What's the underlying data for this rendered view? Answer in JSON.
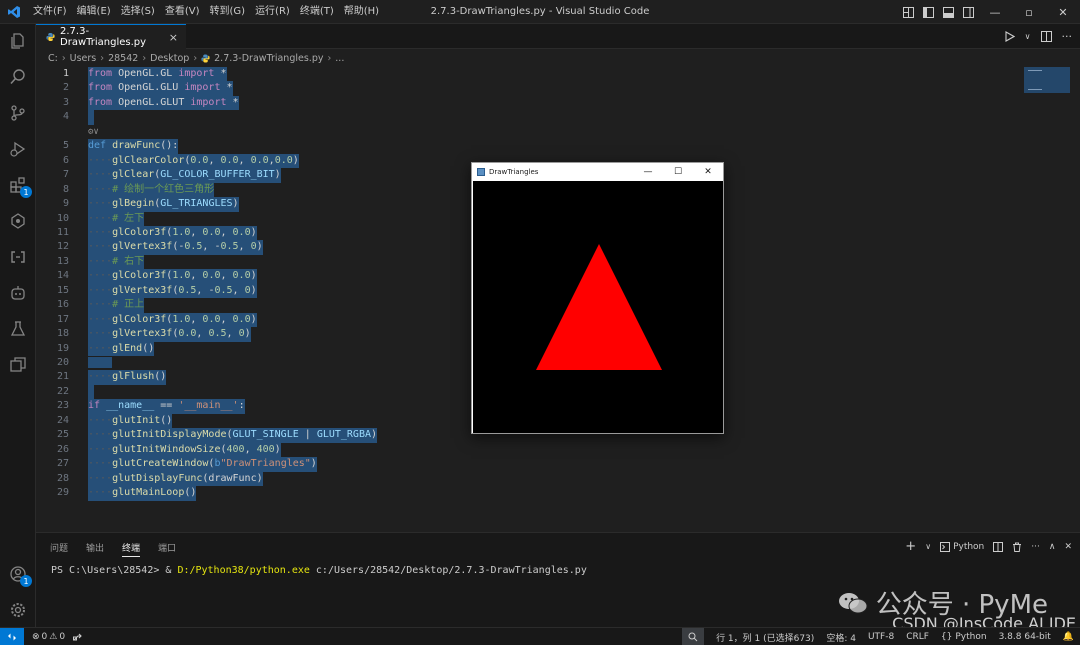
{
  "window": {
    "title": "2.7.3-DrawTriangles.py - Visual Studio Code"
  },
  "menu": [
    "文件(F)",
    "编辑(E)",
    "选择(S)",
    "查看(V)",
    "转到(G)",
    "运行(R)",
    "终端(T)",
    "帮助(H)"
  ],
  "activity_bar": {
    "items": [
      "explorer-icon",
      "search-icon",
      "source-control-icon",
      "run-debug-icon",
      "extensions-icon",
      "testing-icon",
      "remote-icon",
      "copilot-icon",
      "flask-icon",
      "container-icon"
    ],
    "extensions_badge": "1",
    "accounts_badge": "1"
  },
  "tab": {
    "label": "2.7.3-DrawTriangles.py",
    "close": "×"
  },
  "breadcrumb": [
    "C:",
    "Users",
    "28542",
    "Desktop",
    "2.7.3-DrawTriangles.py",
    "..."
  ],
  "editor": {
    "lines": [
      {
        "n": "1",
        "code": "from OpenGL.GL import *"
      },
      {
        "n": "2",
        "code": "from OpenGL.GLU import *"
      },
      {
        "n": "3",
        "code": "from OpenGL.GLUT import *"
      },
      {
        "n": "4",
        "code": ""
      },
      {
        "n": "",
        "code": "⚙∨"
      },
      {
        "n": "5",
        "code": "def drawFunc():"
      },
      {
        "n": "6",
        "code": "    glClearColor(0.0, 0.0, 0.0,0.0)"
      },
      {
        "n": "7",
        "code": "    glClear(GL_COLOR_BUFFER_BIT)"
      },
      {
        "n": "8",
        "code": "    # 绘制一个红色三角形"
      },
      {
        "n": "9",
        "code": "    glBegin(GL_TRIANGLES)"
      },
      {
        "n": "10",
        "code": "    # 左下"
      },
      {
        "n": "11",
        "code": "    glColor3f(1.0, 0.0, 0.0)"
      },
      {
        "n": "12",
        "code": "    glVertex3f(-0.5, -0.5, 0)"
      },
      {
        "n": "13",
        "code": "    # 右下"
      },
      {
        "n": "14",
        "code": "    glColor3f(1.0, 0.0, 0.0)"
      },
      {
        "n": "15",
        "code": "    glVertex3f(0.5, -0.5, 0)"
      },
      {
        "n": "16",
        "code": "    # 正上"
      },
      {
        "n": "17",
        "code": "    glColor3f(1.0, 0.0, 0.0)"
      },
      {
        "n": "18",
        "code": "    glVertex3f(0.0, 0.5, 0)"
      },
      {
        "n": "19",
        "code": "    glEnd()"
      },
      {
        "n": "20",
        "code": ""
      },
      {
        "n": "21",
        "code": "    glFlush()"
      },
      {
        "n": "22",
        "code": ""
      },
      {
        "n": "23",
        "code": "if __name__ == '__main__':"
      },
      {
        "n": "24",
        "code": "    glutInit()"
      },
      {
        "n": "25",
        "code": "    glutInitDisplayMode(GLUT_SINGLE | GLUT_RGBA)"
      },
      {
        "n": "26",
        "code": "    glutInitWindowSize(400, 400)"
      },
      {
        "n": "27",
        "code": "    glutCreateWindow(b\"DrawTriangles\")"
      },
      {
        "n": "28",
        "code": "    glutDisplayFunc(drawFunc)"
      },
      {
        "n": "29",
        "code": "    glutMainLoop()"
      }
    ]
  },
  "gl_window": {
    "title": "DrawTriangles",
    "minimize": "—",
    "maximize": "☐",
    "close": "✕",
    "triangle_color": "#ff0000",
    "background_color": "#000000"
  },
  "panel": {
    "tabs": [
      "问题",
      "输出",
      "终端",
      "端口"
    ],
    "active_tab": "终端",
    "shell_label": "Python",
    "terminal_prompt": "PS C:\\Users\\28542> & ",
    "terminal_exe": "D:/Python38/python.exe",
    "terminal_args": " c:/Users/28542/Desktop/2.7.3-DrawTriangles.py"
  },
  "status_bar": {
    "errors": "0",
    "warnings": "0",
    "position": "行 1，列 1 (已选择673)",
    "indent": "空格: 4",
    "encoding": "UTF-8",
    "eol": "CRLF",
    "language": "Python",
    "interpreter": "3.8.8 64-bit"
  },
  "watermark": {
    "text": "公众号 · PyMe",
    "csdn": "CSDN @InsCode AI IDE"
  },
  "colors": {
    "accent": "#0078d4",
    "selection": "#264f78",
    "editor_bg": "#1f1f1f"
  }
}
